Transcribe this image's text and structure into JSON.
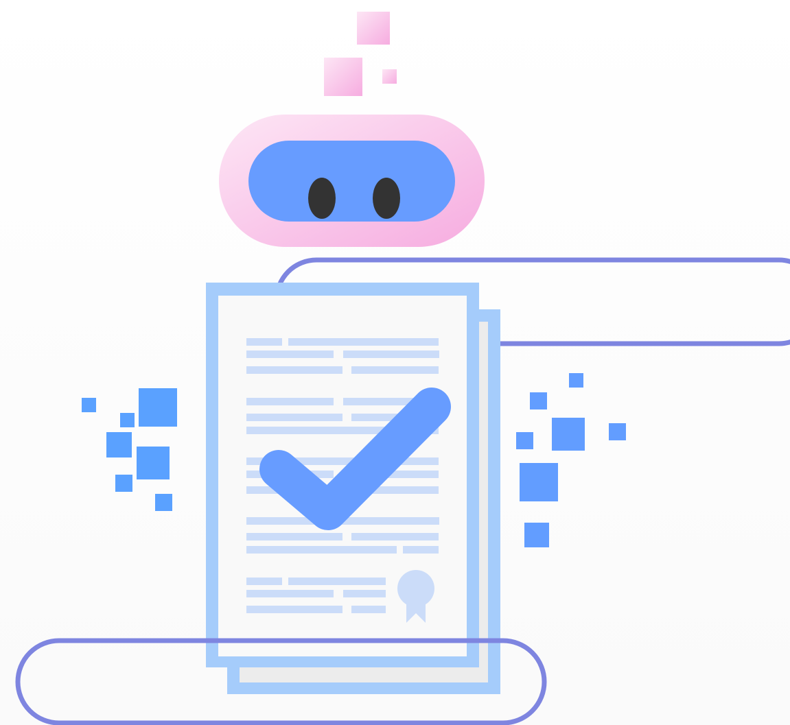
{
  "illustration": {
    "subject": "robot-approved-document",
    "icons": {
      "robot_head": "robot-head-icon",
      "document": "document-icon",
      "checkmark": "checkmark-icon",
      "seal": "certificate-seal-icon"
    }
  },
  "colors": {
    "background": "#fafafa",
    "robot_pink": "#f8c4e8",
    "robot_visor": "#679cff",
    "robot_eye": "#333333",
    "document_frame": "#a5ccfb",
    "document_page": "#f9f9f9",
    "document_back_page": "#ececec",
    "text_lines": "#cbdcf9",
    "checkmark": "#679cff",
    "pixel_blue": "#5aa1ff",
    "pixel_pink": "#f8c4e8",
    "pill_outline": "#7e85e0"
  }
}
